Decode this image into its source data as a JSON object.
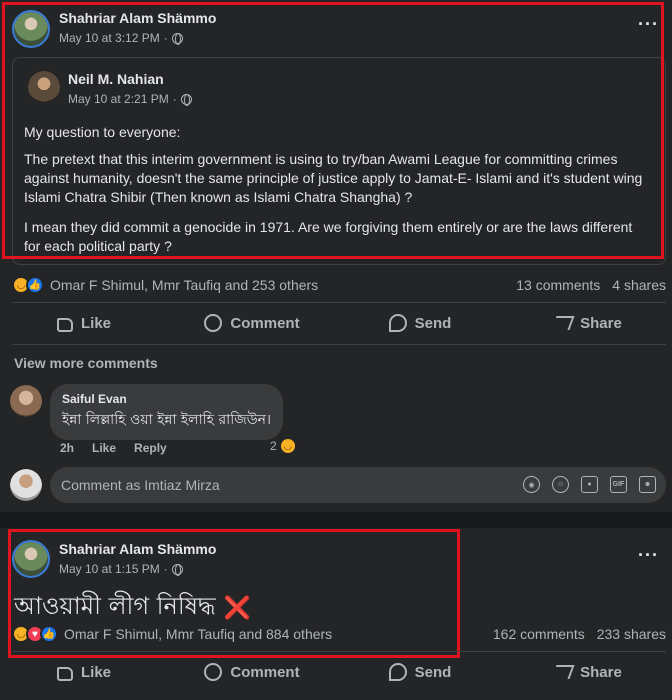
{
  "post1": {
    "author": "Shahriar Alam Shämmo",
    "time": "May 10 at 3:12 PM",
    "shared": {
      "author": "Neil M. Nahian",
      "time": "May 10 at 2:21 PM",
      "paragraphs": [
        "My question to everyone:",
        "The pretext that this interim government is using to try/ban Awami League for committing crimes against humanity, doesn't the same principle of justice apply to Jamat-E- Islami  and it's student wing Islami Chatra Shibir (Then known as Islami Chatra Shangha) ?",
        "I mean they did commit a genocide in 1971. Are we forgiving them entirely or are the laws different for each political party ?"
      ]
    },
    "reactions_text": "Omar F Shimul, Mmr Taufiq and 253 others",
    "comments_count": "13 comments",
    "shares_count": "4 shares",
    "view_more": "View more comments",
    "comment": {
      "author": "Saiful Evan",
      "text": "ইন্না লিল্লাহি ওয়া ইন্না ইলাহি রাজিউন।",
      "time": "2h",
      "like": "Like",
      "reply": "Reply",
      "reaction_count": "2"
    },
    "compose_placeholder": "Comment as Imtiaz Mirza"
  },
  "post2": {
    "author": "Shahriar Alam Shämmo",
    "time": "May 10 at 1:15 PM",
    "text": "আওয়ামী লীগ নিষিদ্ধ",
    "emoji": "❌",
    "reactions_text": "Omar F Shimul, Mmr Taufiq and 884 others",
    "comments_count": "162 comments",
    "shares_count": "233 shares"
  },
  "actions": {
    "like": "Like",
    "comment": "Comment",
    "send": "Send",
    "share": "Share"
  },
  "compose_icons": [
    "sticker-icon",
    "emoji-icon",
    "camera-icon",
    "gif-icon",
    "avatar-sticker-icon"
  ],
  "colors": {
    "background": "#18191a",
    "card": "#242526",
    "highlight_border": "#e0141e",
    "like_blue": "#1877f2",
    "sad_yellow": "#f7b125",
    "love_red": "#f33e58"
  }
}
